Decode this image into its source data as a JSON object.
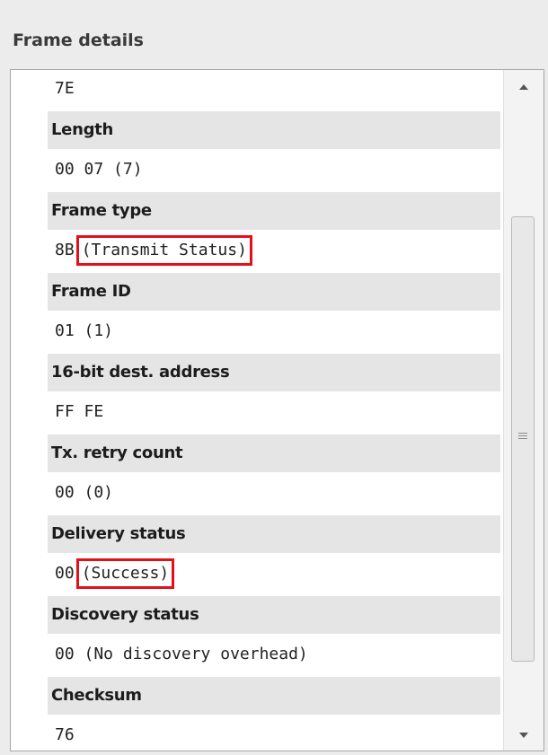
{
  "panel": {
    "title": "Frame details"
  },
  "fields": [
    {
      "kind": "value",
      "text": "7E"
    },
    {
      "kind": "header",
      "text": "Length"
    },
    {
      "kind": "value",
      "text": "00 07 (7)"
    },
    {
      "kind": "header",
      "text": "Frame type"
    },
    {
      "kind": "value",
      "prefix": "8B",
      "highlight": "(Transmit Status)"
    },
    {
      "kind": "header",
      "text": "Frame ID"
    },
    {
      "kind": "value",
      "text": "01 (1)"
    },
    {
      "kind": "header",
      "text": "16-bit dest. address"
    },
    {
      "kind": "value",
      "text": "FF FE"
    },
    {
      "kind": "header",
      "text": "Tx. retry count"
    },
    {
      "kind": "value",
      "text": "00 (0)"
    },
    {
      "kind": "header",
      "text": "Delivery status"
    },
    {
      "kind": "value",
      "prefix": "00",
      "highlight": "(Success)"
    },
    {
      "kind": "header",
      "text": "Discovery status"
    },
    {
      "kind": "value",
      "text": "00 (No discovery overhead)"
    },
    {
      "kind": "header",
      "text": "Checksum"
    },
    {
      "kind": "value",
      "text": "76"
    }
  ],
  "colors": {
    "highlight_border": "#e3101b",
    "header_bg": "#e5e5e5"
  },
  "icons": {
    "scroll_up": "scroll-up-arrow-icon",
    "scroll_down": "scroll-down-arrow-icon",
    "grip": "scrollbar-grip-icon"
  }
}
